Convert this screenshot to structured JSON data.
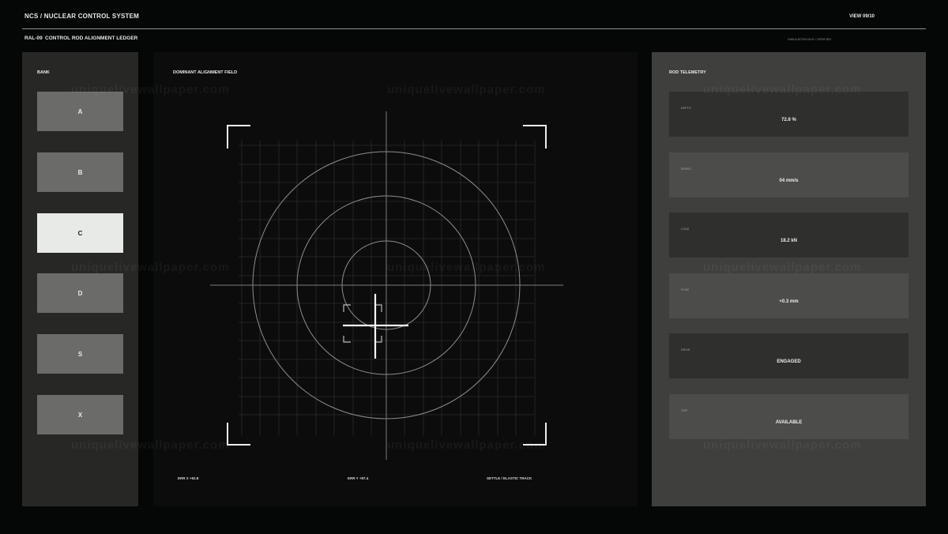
{
  "header": {
    "title": "NCS / NUCLEAR CONTROL SYSTEM",
    "view": "VIEW 09/10",
    "ledger_id": "RAL-09",
    "ledger_title": "CONTROL ROD ALIGNMENT LEDGER",
    "status": "SIMULATION BUS / VERIFIED"
  },
  "bank": {
    "label": "BANK",
    "items": [
      "A",
      "B",
      "C",
      "D",
      "S",
      "X"
    ],
    "active": "C"
  },
  "field": {
    "label": "DOMINANT ALIGNMENT FIELD",
    "err_x": "ERR X +52.8",
    "err_y": "ERR Y +87.4",
    "mode": "SETTLE / ELASTIC TRACK"
  },
  "telemetry": {
    "label": "ROD TELEMETRY",
    "cards": [
      {
        "label": "DEPTH",
        "value": "72.6 %"
      },
      {
        "label": "SPEED",
        "value": "04 mm/s"
      },
      {
        "label": "LOAD",
        "value": "18.2 kN"
      },
      {
        "label": "SYNC",
        "value": "+0.3 mm"
      },
      {
        "label": "DRIVE",
        "value": "ENGAGED"
      },
      {
        "label": "TRIP",
        "value": "AVAILABLE"
      }
    ]
  },
  "watermark": "uniquelivewallpaper.com",
  "colors": {
    "background": "#050606",
    "panel_left": "#272826",
    "panel_center": "#0b0c0b",
    "panel_right": "#3f403e",
    "button": "#6b6c6a",
    "button_active": "#e8eae7"
  }
}
